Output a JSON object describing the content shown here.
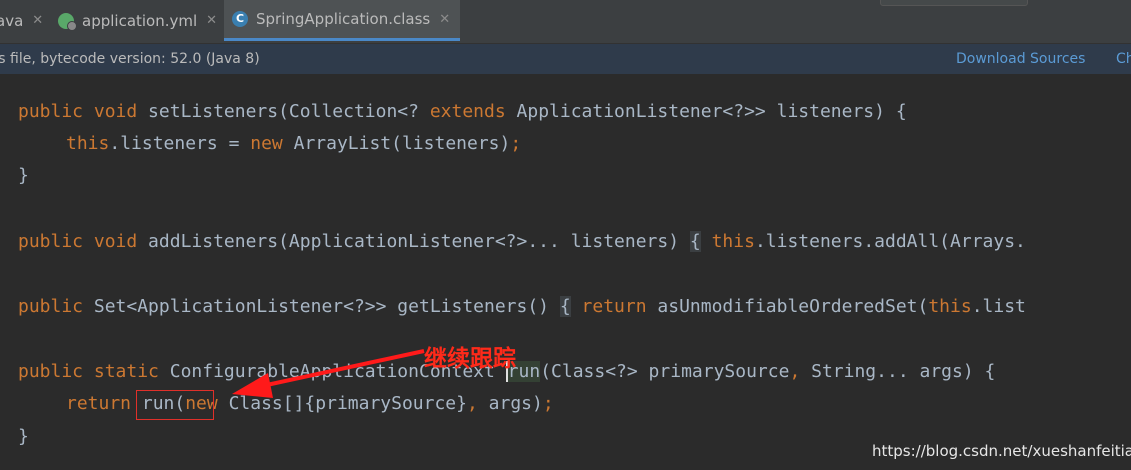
{
  "tabs": [
    {
      "label": "ava",
      "close": "✕",
      "active": false
    },
    {
      "label": "application.yml",
      "close": "✕",
      "active": false,
      "icon": "yml-file-icon"
    },
    {
      "label": "SpringApplication.class",
      "close": "✕",
      "active": true,
      "icon": "class-file-icon"
    }
  ],
  "banner": {
    "message": "ss file, bytecode version: 52.0 (Java 8)",
    "download_sources": "Download Sources",
    "choose_sources": "Ch"
  },
  "annotation": "继续跟踪",
  "watermark": "https://blog.csdn.net/xueshanfeitian",
  "code": {
    "l1": {
      "a": "public void",
      "b": " setListeners(Collection<? ",
      "c": "extends",
      "d": " ApplicationListener<?>> listeners) {"
    },
    "l2": {
      "a": "this",
      "b": ".listeners = ",
      "c": "new",
      "d": " ArrayList(listeners)",
      "e": ";"
    },
    "l3": {
      "a": "}"
    },
    "l4": {
      "a": "public void",
      "b": " addListeners(ApplicationListener<?>... listeners) ",
      "c": "{",
      "d": " ",
      "e": "this",
      "f": ".listeners.addAll(Arrays."
    },
    "l5": {
      "a": "public",
      "b": " Set<ApplicationListener<?>> getListeners() ",
      "c": "{",
      "d": " ",
      "e": "return",
      "f": " asUnmodifiableOrderedSet(",
      "g": "this",
      "h": ".list"
    },
    "l6": {
      "a": "public static",
      "b": " ConfigurableApplicationContext ",
      "c": "run",
      "d": "(Class<?> primarySource",
      ",e": "",
      "e": ", ",
      "f": "String... args) {"
    },
    "l7": {
      "a": "return",
      "b": " run(",
      "c": "new",
      "d": " Class[]{primarySource}",
      ",e": "",
      "e": ", ",
      "f": "args)",
      "g": ";"
    },
    "l8": {
      "a": "}"
    }
  }
}
